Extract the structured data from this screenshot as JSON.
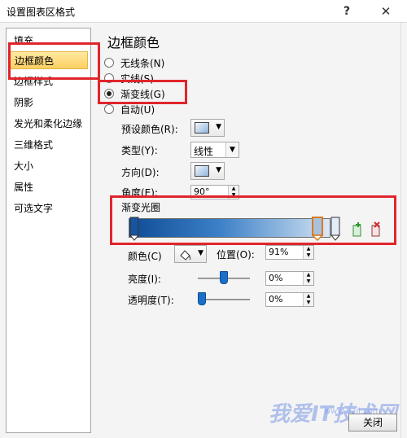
{
  "window": {
    "title": "设置图表区格式",
    "help_glyph": "?",
    "close_glyph": "✕"
  },
  "sidebar": {
    "items": [
      {
        "label": "填充"
      },
      {
        "label": "边框颜色",
        "selected": true
      },
      {
        "label": "边框样式"
      },
      {
        "label": "阴影"
      },
      {
        "label": "发光和柔化边缘"
      },
      {
        "label": "三维格式"
      },
      {
        "label": "大小"
      },
      {
        "label": "属性"
      },
      {
        "label": "可选文字"
      }
    ]
  },
  "main": {
    "section_title": "边框颜色",
    "options": [
      {
        "label": "无线条(N)",
        "checked": false
      },
      {
        "label": "实线(S)",
        "checked": false
      },
      {
        "label": "渐变线(G)",
        "checked": true
      },
      {
        "label": "自动(U)",
        "checked": false
      }
    ],
    "preset_color_label": "预设颜色(R):",
    "type_label": "类型(Y):",
    "type_value": "线性",
    "direction_label": "方向(D):",
    "angle_label": "角度(E):",
    "angle_value": "90°",
    "gradient_stops_label": "渐变光圈",
    "color_label": "颜色(C)",
    "position_label": "位置(O):",
    "position_value": "91%",
    "brightness_label": "亮度(I):",
    "brightness_value": "0%",
    "brightness_level": 0.5,
    "transparency_label": "透明度(T):",
    "transparency_value": "0%",
    "transparency_level": 0.0
  },
  "footer": {
    "close_label": "关闭"
  },
  "watermark": {
    "text": "我爱IT技术网",
    "url": "www.52ij.com"
  },
  "colors": {
    "highlight": "#e0252b",
    "selected_item": "#fcd86f",
    "gradient_dark": "#0f4d95",
    "gradient_light": "#dde9f6"
  }
}
